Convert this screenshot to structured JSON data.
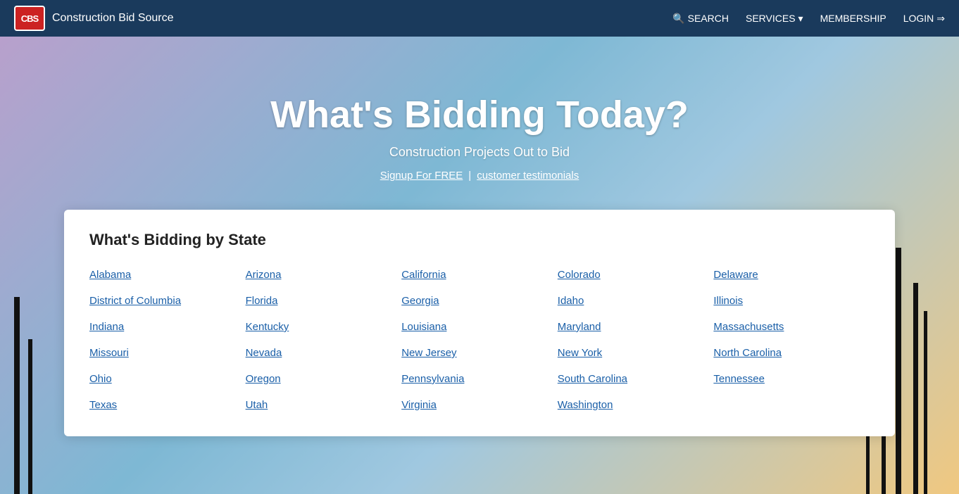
{
  "nav": {
    "logo_text": "CBS",
    "site_name": "Construction Bid Source",
    "links": [
      {
        "label": "SEARCH",
        "name": "search-link",
        "icon": "🔍"
      },
      {
        "label": "SERVICES",
        "name": "services-link",
        "has_dropdown": true
      },
      {
        "label": "MEMBERSHIP",
        "name": "membership-link"
      },
      {
        "label": "LOGIN",
        "name": "login-link",
        "icon": "→"
      }
    ]
  },
  "hero": {
    "title": "What's Bidding Today?",
    "subtitle": "Construction Projects Out to Bid",
    "signup_label": "Signup For FREE",
    "divider": "|",
    "testimonials_label": "customer testimonials"
  },
  "card": {
    "title": "What's Bidding by State",
    "states": [
      "Alabama",
      "Arizona",
      "California",
      "Colorado",
      "Delaware",
      "District of Columbia",
      "Florida",
      "Georgia",
      "Idaho",
      "Illinois",
      "Indiana",
      "Kentucky",
      "Louisiana",
      "Maryland",
      "Massachusetts",
      "Missouri",
      "Nevada",
      "New Jersey",
      "New York",
      "North Carolina",
      "Ohio",
      "Oregon",
      "Pennsylvania",
      "South Carolina",
      "Tennessee",
      "Texas",
      "Utah",
      "Virginia",
      "Washington",
      ""
    ]
  }
}
